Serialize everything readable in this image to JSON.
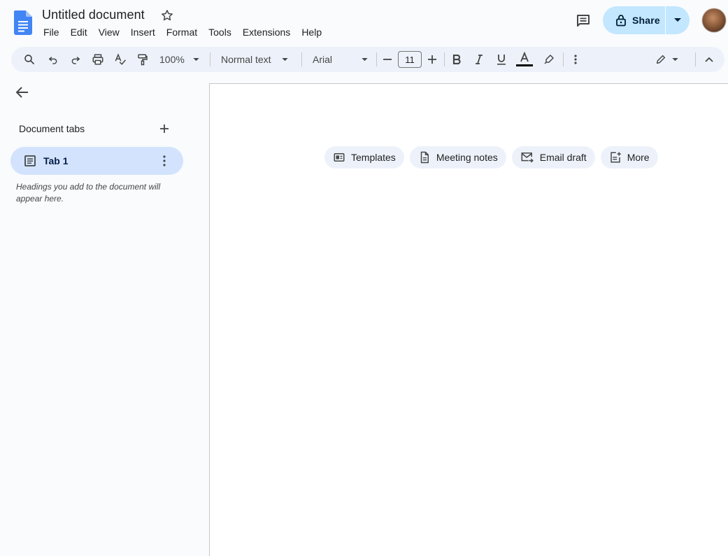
{
  "document": {
    "title": "Untitled document"
  },
  "menu": [
    "File",
    "Edit",
    "View",
    "Insert",
    "Format",
    "Tools",
    "Extensions",
    "Help"
  ],
  "share": {
    "label": "Share"
  },
  "toolbar": {
    "zoom": "100%",
    "style": "Normal text",
    "font": "Arial",
    "font_size": "11"
  },
  "sidebar": {
    "title": "Document tabs",
    "tabs": [
      {
        "label": "Tab 1"
      }
    ],
    "hint": "Headings you add to the document will appear here."
  },
  "chips": [
    {
      "label": "Templates",
      "icon": "templates-icon"
    },
    {
      "label": "Meeting notes",
      "icon": "document-icon"
    },
    {
      "label": "Email draft",
      "icon": "email-draft-icon"
    },
    {
      "label": "More",
      "icon": "note-add-icon"
    }
  ],
  "colors": {
    "brand_blue": "#4285f4",
    "share_bg": "#c2e7ff",
    "toolbar_bg": "#edf2fa",
    "active_tab_bg": "#d3e3fd"
  }
}
